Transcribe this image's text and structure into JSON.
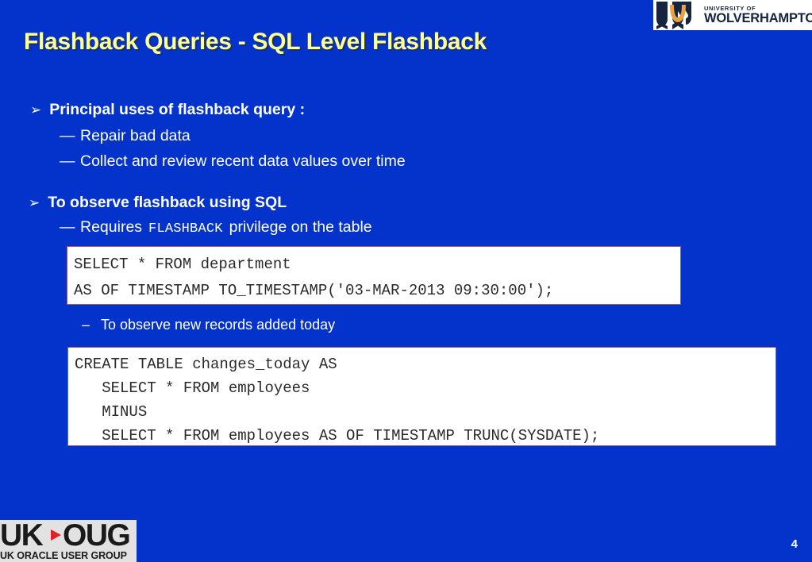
{
  "slide": {
    "background_color": "#0433cc",
    "title": "Flashback Queries - SQL Level Flashback",
    "title_color": "#ffff99",
    "page_number": "4"
  },
  "university_logo": {
    "line1": "UNIVERSITY OF",
    "line2": "WOLVERHAMPTON",
    "mark_navy": "#16243f",
    "mark_gold": "#e8a33d"
  },
  "ukoug_logo": {
    "uk": "UK",
    "oug": "OUG",
    "tagline": "UK ORACLE USER GROUP",
    "accent_color": "#e01f26"
  },
  "content": {
    "bullet1": {
      "arrow": "➢",
      "text": "Principal uses of flashback query :"
    },
    "bullet1_subs": [
      {
        "dash": "—",
        "text": "Repair bad data"
      },
      {
        "dash": "—",
        "text": "Collect and review recent data values over time"
      }
    ],
    "bullet2": {
      "arrow": "➢",
      "text": "To observe flashback using SQL"
    },
    "bullet2_sub": {
      "dash": "—",
      "text_before": "Requires",
      "mono": "FLASHBACK",
      "text_after": "privilege on the table"
    },
    "bullet3_sub": {
      "dash": "–",
      "text": "To observe new records added today"
    }
  },
  "code_boxes": [
    {
      "border_color": "#9c5a78",
      "lines": [
        "SELECT * FROM department",
        "AS OF TIMESTAMP TO_TIMESTAMP('03-MAR-2013 09:30:00');"
      ]
    },
    {
      "border_color": "#9c5a78",
      "lines": [
        "CREATE TABLE changes_today AS",
        "   SELECT * FROM employees",
        "   MINUS",
        "   SELECT * FROM employees AS OF TIMESTAMP TRUNC(SYSDATE);"
      ]
    }
  ]
}
